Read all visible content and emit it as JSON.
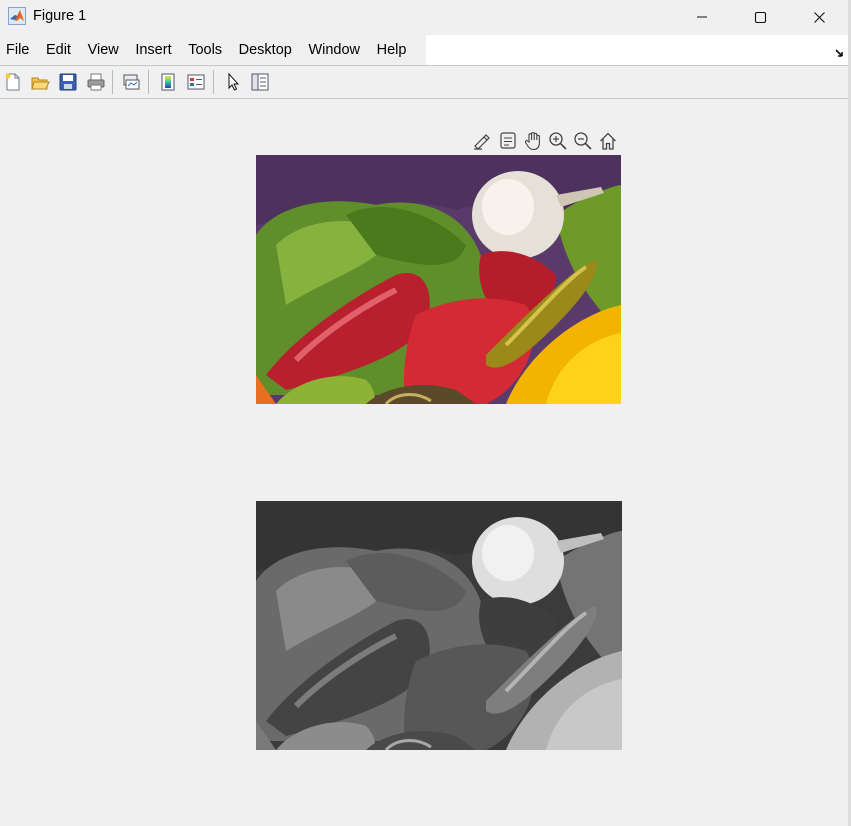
{
  "window": {
    "title": "Figure 1",
    "controls": [
      "minimize",
      "maximize",
      "close"
    ]
  },
  "menu": {
    "items": [
      "File",
      "Edit",
      "View",
      "Insert",
      "Tools",
      "Desktop",
      "Window",
      "Help"
    ]
  },
  "toolbar": {
    "buttons": [
      "new-figure-icon",
      "open-file-icon",
      "save-icon",
      "print-icon",
      "link-plot-icon",
      "insert-colorbar-icon",
      "insert-legend-icon",
      "edit-plot-icon",
      "property-inspector-icon"
    ]
  },
  "axes_toolbar": {
    "buttons": [
      "brush-icon",
      "data-tips-icon",
      "pan-icon",
      "zoom-in-icon",
      "zoom-out-icon",
      "restore-view-icon"
    ]
  },
  "figure": {
    "subplots": [
      {
        "name": "color-peppers-image",
        "kind": "rgb"
      },
      {
        "name": "grayscale-peppers-image",
        "kind": "grayscale"
      }
    ]
  },
  "colors": {
    "background": "#f0f0f0",
    "menu_strip_white": "#ffffff",
    "matlab_orange": "#e16624"
  }
}
